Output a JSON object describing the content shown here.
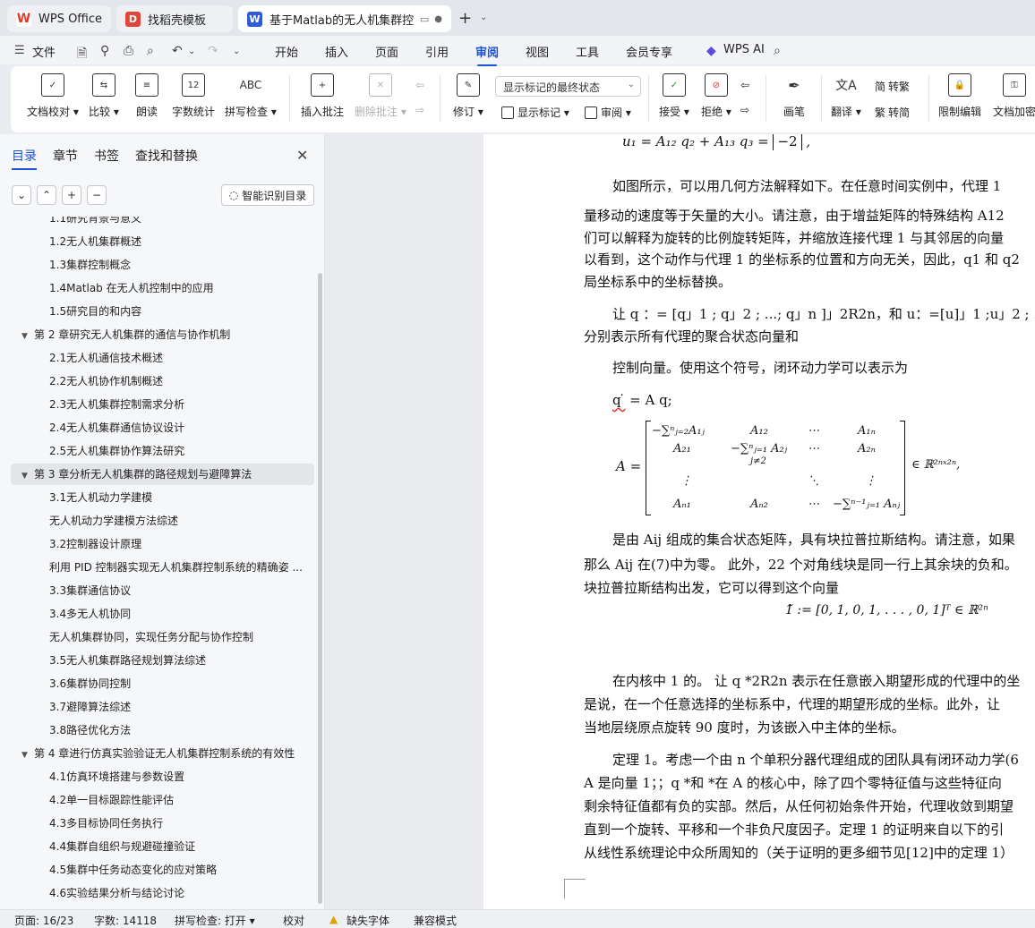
{
  "tabs": [
    {
      "label": "WPS Office",
      "icon": "wps-logo-icon",
      "color": "#e23b2e"
    },
    {
      "label": "找稻壳模板",
      "icon": "docer-icon",
      "color": "#e0463b"
    },
    {
      "label": "基于Matlab的无人机集群控制",
      "icon": "word-doc-icon",
      "color": "#2f5bd9"
    }
  ],
  "menu": {
    "file": "文件",
    "items": [
      "开始",
      "插入",
      "页面",
      "引用",
      "审阅",
      "视图",
      "工具",
      "会员专享"
    ],
    "active": "审阅",
    "ai": "WPS AI"
  },
  "ribbon": {
    "doc_check": "文档校对",
    "compare": "比较",
    "read_aloud": "朗读",
    "word_count": "字数统计",
    "word_count_icon": "12",
    "spell_check": "拼写检查",
    "spell_icon": "ABC",
    "insert_comment": "插入批注",
    "delete_comment": "删除批注",
    "revise": "修订",
    "markup_state": "显示标记的最终状态",
    "show_markup": "显示标记",
    "review": "审阅",
    "accept": "接受",
    "reject": "拒绝",
    "pen": "画笔",
    "translate": "翻译",
    "to_traditional": "转繁",
    "to_simplified": "转简",
    "restrict_edit": "限制编辑",
    "doc_encrypt": "文档加密"
  },
  "nav": {
    "tabs": [
      "目录",
      "章节",
      "书签",
      "查找和替换"
    ],
    "active_tab": "目录",
    "smart_button": "智能识别目录",
    "items": [
      {
        "text": "1.1研究背景与意义",
        "level": 2
      },
      {
        "text": "1.2无人机集群概述",
        "level": 2
      },
      {
        "text": "1.3集群控制概念",
        "level": 2
      },
      {
        "text": "1.4Matlab 在无人机控制中的应用",
        "level": 2
      },
      {
        "text": "1.5研究目的和内容",
        "level": 2
      },
      {
        "text": "第 2 章研究无人机集群的通信与协作机制",
        "level": 1
      },
      {
        "text": "2.1无人机通信技术概述",
        "level": 2
      },
      {
        "text": "2.2无人机协作机制概述",
        "level": 2
      },
      {
        "text": "2.3无人机集群控制需求分析",
        "level": 2
      },
      {
        "text": "2.4无人机集群通信协议设计",
        "level": 2
      },
      {
        "text": "2.5无人机集群协作算法研究",
        "level": 2
      },
      {
        "text": "第 3 章分析无人机集群的路径规划与避障算法",
        "level": 1,
        "selected": true
      },
      {
        "text": "3.1无人机动力学建模",
        "level": 2
      },
      {
        "text": "无人机动力学建模方法综述",
        "level": 2
      },
      {
        "text": "3.2控制器设计原理",
        "level": 2
      },
      {
        "text": "利用 PID 控制器实现无人机集群控制系统的精确姿 ...",
        "level": 2
      },
      {
        "text": "3.3集群通信协议",
        "level": 2
      },
      {
        "text": "3.4多无人机协同",
        "level": 2
      },
      {
        "text": "无人机集群协同，实现任务分配与协作控制",
        "level": 2
      },
      {
        "text": "3.5无人机集群路径规划算法综述",
        "level": 2
      },
      {
        "text": "3.6集群协同控制",
        "level": 2
      },
      {
        "text": "3.7避障算法综述",
        "level": 2
      },
      {
        "text": "3.8路径优化方法",
        "level": 2
      },
      {
        "text": "第 4 章进行仿真实验验证无人机集群控制系统的有效性",
        "level": 1
      },
      {
        "text": "4.1仿真环境搭建与参数设置",
        "level": 2
      },
      {
        "text": "4.2单一目标跟踪性能评估",
        "level": 2
      },
      {
        "text": "4.3多目标协同任务执行",
        "level": 2
      },
      {
        "text": "4.4集群自组织与规避碰撞验证",
        "level": 2
      },
      {
        "text": "4.5集群中任务动态变化的应对策略",
        "level": 2
      },
      {
        "text": "4.6实验结果分析与结论讨论",
        "level": 2
      }
    ]
  },
  "doc": {
    "eq_top": "u₁ = A₁₂ q₂ + A₁₃ q₃ = ",
    "eq_top_vec": "−2",
    "para1": [
      "如图所示，可以用几何方法解释如下。在任意时间实例中，代理 1 ",
      "量移动的速度等于矢量的大小。请注意，由于增益矩阵的特殊结构 A12",
      "们可以解释为旋转的比例旋转矩阵，并缩放连接代理 1 与其邻居的向量",
      "以看到，这个动作与代理 1 的坐标系的位置和方向无关，因此，q1 和 q2",
      "局坐标系中的坐标替换。"
    ],
    "para2": [
      "让 q ：= [q」1 ; q」2 ; ...; q」n ]」2R2n，和 u：=[u]」1 ;u」2 ; ...; u」n",
      "分别表示所有代理的聚合状态向量和"
    ],
    "para3": "控制向量。使用这个符号，闭环动力学可以表示为",
    "eq_dyn_q": "q ̇",
    "eq_dyn_rest": " = A q;",
    "matrix": {
      "lhs": "A =",
      "r1": [
        "−∑ⁿⱼ₌₂A₁ⱼ",
        "A₁₂",
        "⋯",
        "A₁ₙ"
      ],
      "r2": [
        "A₂₁",
        "−∑ⁿⱼ₌₁ A₂ⱼ",
        "⋯",
        "A₂ₙ"
      ],
      "r2sub": "j≠2",
      "r3": [
        "⋮",
        "",
        "⋱",
        "⋮"
      ],
      "r4": [
        "Aₙ₁",
        "Aₙ₂",
        "⋯",
        "−∑ⁿ⁻¹ⱼ₌₁ Aₙⱼ"
      ],
      "rhs": "∈ ℝ²ⁿˣ²ⁿ,"
    },
    "para4": [
      "是由 Aij 组成的集合状态矩阵，具有块拉普拉斯结构。请注意，如果",
      "那么  Aij 在(7)中为零。 此外，22 个对角线块是同一行上其余块的负和。",
      "块拉普拉斯结构出发，它可以得到这个向量"
    ],
    "eq_one": "1̃ := [0, 1, 0, 1, . . . , 0, 1]ᵀ ∈ ℝ²ⁿ",
    "para5": [
      "在内核中 1 的。 让 q *2R2n 表示在任意嵌入期望形成的代理中的坐",
      "是说，在一个任意选择的坐标系中，代理的期望形成的坐标。此外，让",
      "当地层绕原点旋转 90 度时，为该嵌入中主体的坐标。"
    ],
    "para6": [
      "定理 1。考虑一个由 n 个单积分器代理组成的团队具有闭环动力学(6",
      "A 是向量 1；；q *和  *在 A 的核心中，除了四个零特征值与这些特征向",
      "剩余特征值都有负的实部。然后，从任何初始条件开始，代理收敛到期望",
      "直到一个旋转、平移和一个非负尺度因子。定理 1 的证明来自以下的引",
      "从线性系统理论中众所周知的（关于证明的更多细节见[12]中的定理 1）"
    ]
  },
  "status": {
    "page": "页面: 16/23",
    "words": "字数: 14118",
    "spell": "拼写检查: 打开",
    "proof": "校对",
    "missing_font": "缺失字体",
    "compat": "兼容模式"
  }
}
